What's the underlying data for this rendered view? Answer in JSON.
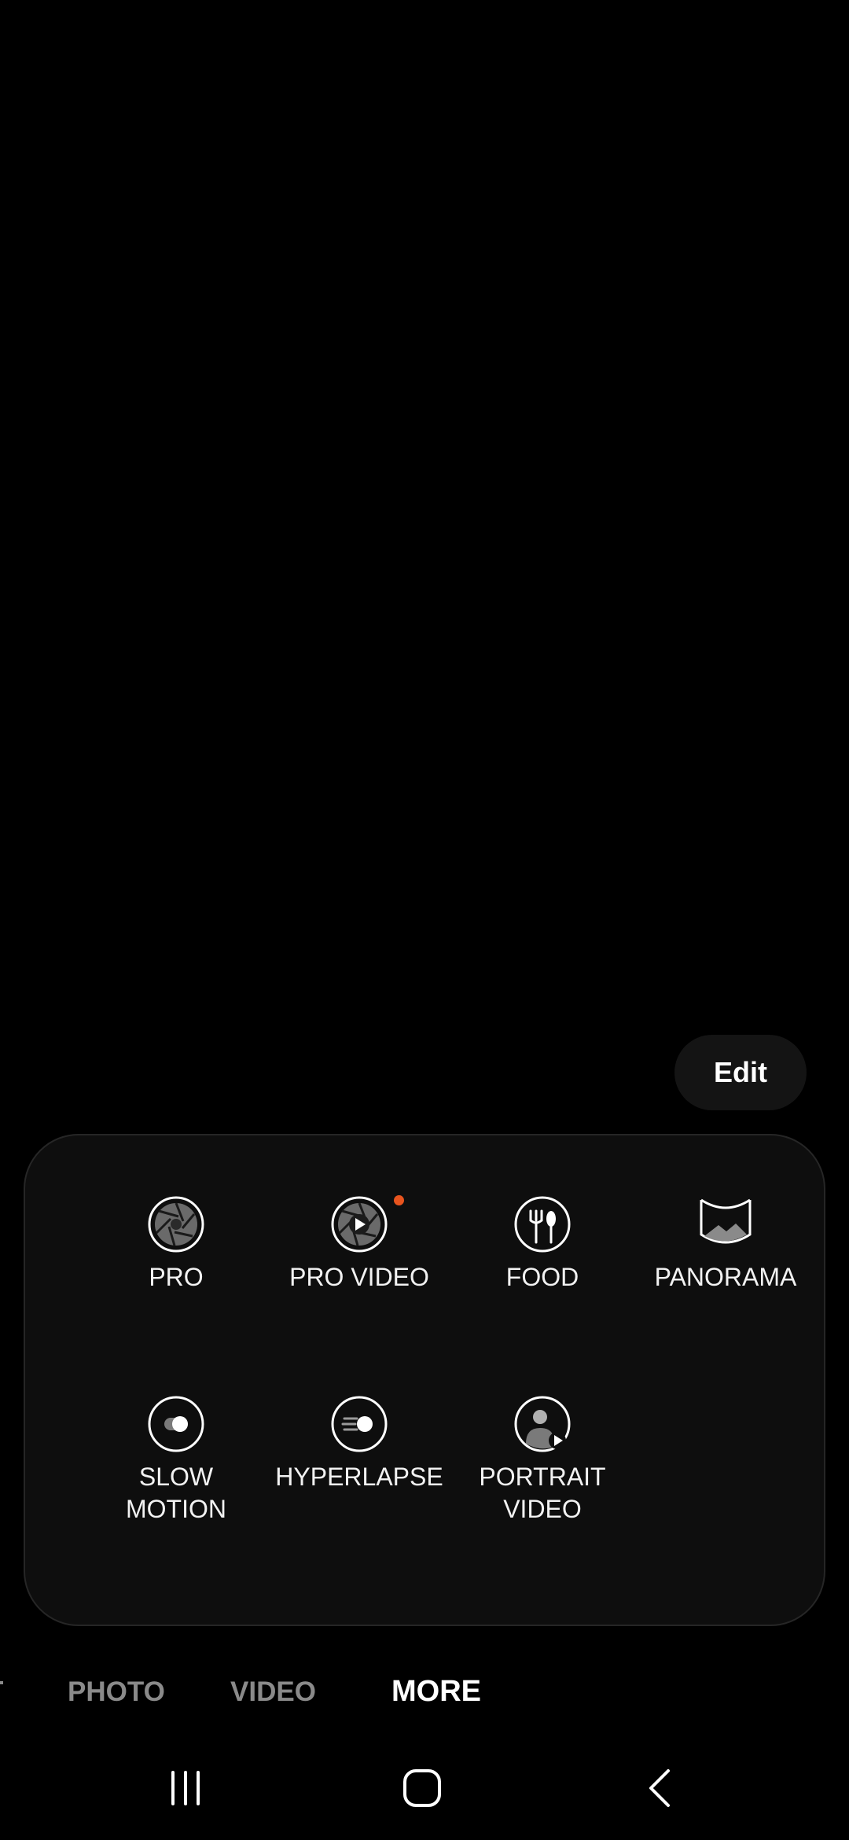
{
  "edit_label": "Edit",
  "modes": [
    {
      "label": "PRO",
      "icon": "pro-aperture-icon"
    },
    {
      "label": "PRO VIDEO",
      "icon": "pro-video-aperture-icon",
      "new": true
    },
    {
      "label": "FOOD",
      "icon": "food-icon"
    },
    {
      "label": "PANORAMA",
      "icon": "panorama-icon"
    },
    {
      "label": "SLOW\nMOTION",
      "icon": "slow-motion-icon"
    },
    {
      "label": "HYPERLAPSE",
      "icon": "hyperlapse-icon"
    },
    {
      "label": "PORTRAIT\nVIDEO",
      "icon": "portrait-video-icon"
    }
  ],
  "tabs": {
    "photo": "PHOTO",
    "video": "VIDEO",
    "more": "MORE"
  },
  "colors": {
    "new_dot": "#e8541e",
    "inactive_tab": "#8a8a8a",
    "active_tab": "#ffffff"
  },
  "nav": {
    "recents": "recents-icon",
    "home": "home-icon",
    "back": "back-icon"
  }
}
